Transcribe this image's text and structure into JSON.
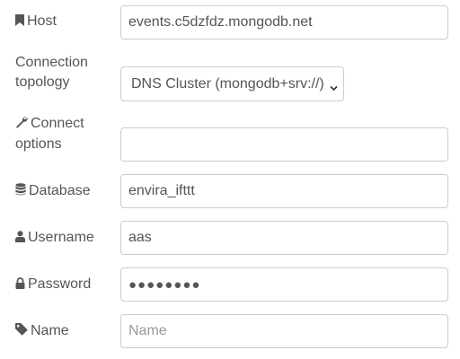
{
  "fields": {
    "host": {
      "label": "Host",
      "value": "events.c5dzfdz.mongodb.net"
    },
    "topology": {
      "label_line1": "Connection",
      "label_line2": "topology",
      "value": "DNS Cluster (mongodb+srv://)"
    },
    "connect_options": {
      "label_line1": "Connect",
      "label_line2": "options",
      "value": ""
    },
    "database": {
      "label": "Database",
      "value": "envira_ifttt"
    },
    "username": {
      "label": "Username",
      "value": "aas"
    },
    "password": {
      "label": "Password",
      "value": "●●●●●●●●"
    },
    "name": {
      "label": "Name",
      "value": "",
      "placeholder": "Name"
    }
  },
  "icons": {
    "host": "bookmark-icon",
    "connect_options": "wrench-icon",
    "database": "database-icon",
    "username": "user-icon",
    "password": "lock-icon",
    "name": "tag-icon",
    "topology_dropdown": "chevron-down-icon"
  },
  "colors": {
    "label_text": "#555555",
    "border": "#cccccc",
    "placeholder": "#999999"
  }
}
